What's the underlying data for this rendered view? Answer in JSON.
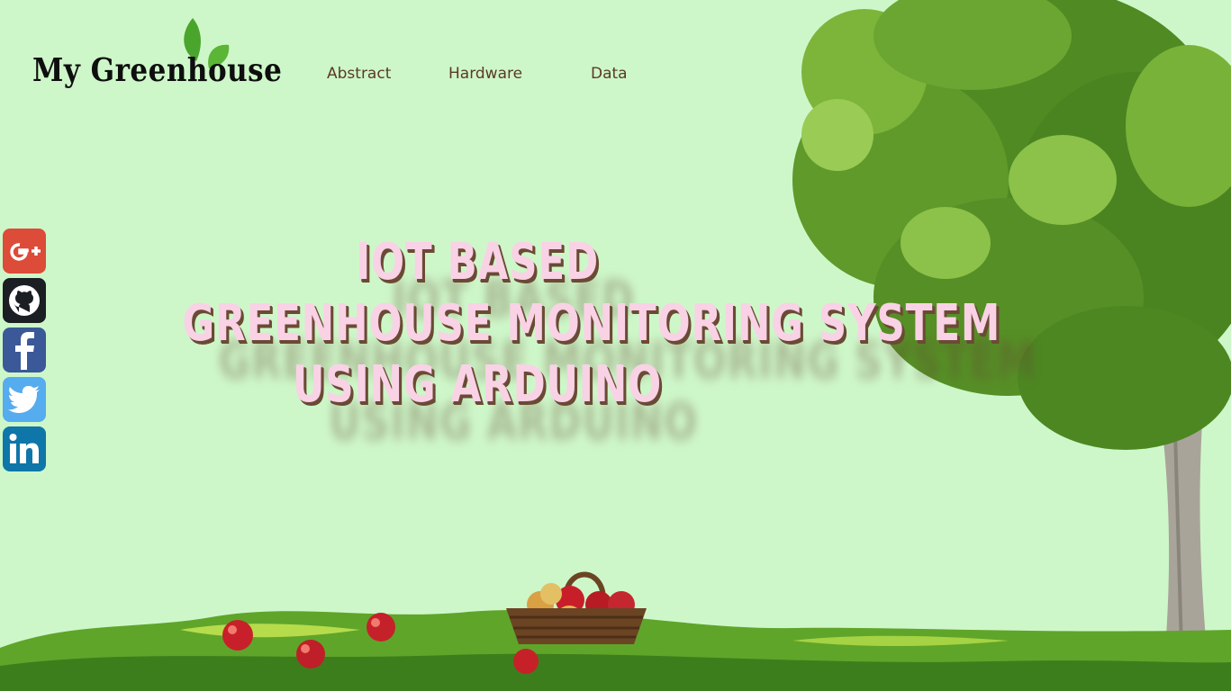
{
  "logo": {
    "text": "My Greenhouse"
  },
  "nav": {
    "items": [
      {
        "label": "Abstract"
      },
      {
        "label": "Hardware"
      },
      {
        "label": "Data"
      }
    ]
  },
  "hero": {
    "lines": [
      "IOT BASED",
      "GREENHOUSE MONITORING SYSTEM",
      "USING ARDUINO"
    ]
  },
  "socials": [
    {
      "name": "google-plus",
      "color": "#dd4b39"
    },
    {
      "name": "github",
      "color": "#1b1f23"
    },
    {
      "name": "facebook",
      "color": "#3b5998"
    },
    {
      "name": "twitter",
      "color": "#55acee"
    },
    {
      "name": "linkedin",
      "color": "#0e76a8"
    }
  ],
  "theme": {
    "background": "#cef7c9",
    "headline": "#f9d2e6",
    "nav_text": "#5a3b22"
  }
}
